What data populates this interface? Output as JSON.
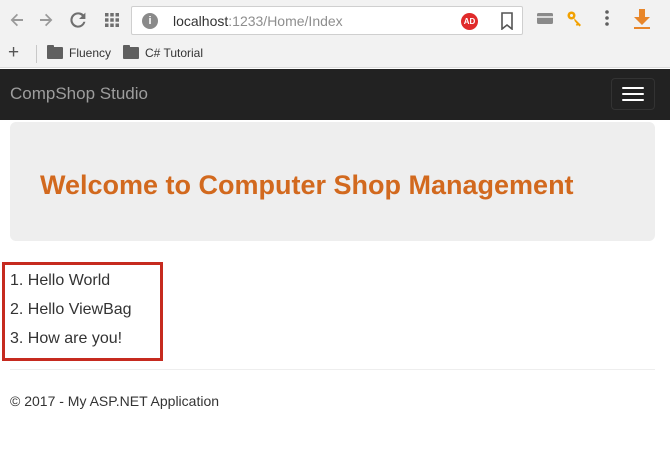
{
  "browser": {
    "url_host": "localhost",
    "url_rest": ":1233/Home/Index",
    "ad_badge": "AD",
    "icons": {
      "back": "back-arrow-icon",
      "forward": "forward-arrow-icon",
      "reload": "reload-icon",
      "apps": "apps-grid-icon",
      "site_info": "site-info-icon",
      "bookmark": "bookmark-icon",
      "card": "card-icon",
      "key": "key-icon",
      "menu": "kebab-menu-icon",
      "download": "download-icon"
    },
    "colors": {
      "key": "#f2a100",
      "download": "#e8862a",
      "ad": "#e02a2a"
    }
  },
  "bookmarks": {
    "items": [
      {
        "label": "Fluency"
      },
      {
        "label": "C# Tutorial"
      }
    ]
  },
  "navbar": {
    "brand": "CompShop Studio"
  },
  "jumbotron": {
    "title": "Welcome to Computer Shop Management",
    "title_color": "#d2691e"
  },
  "list": {
    "items": [
      "1. Hello World",
      "2. Hello ViewBag",
      "3. How are you!"
    ],
    "highlight_color": "#c62a1f"
  },
  "footer": {
    "text": "© 2017 - My ASP.NET Application"
  }
}
